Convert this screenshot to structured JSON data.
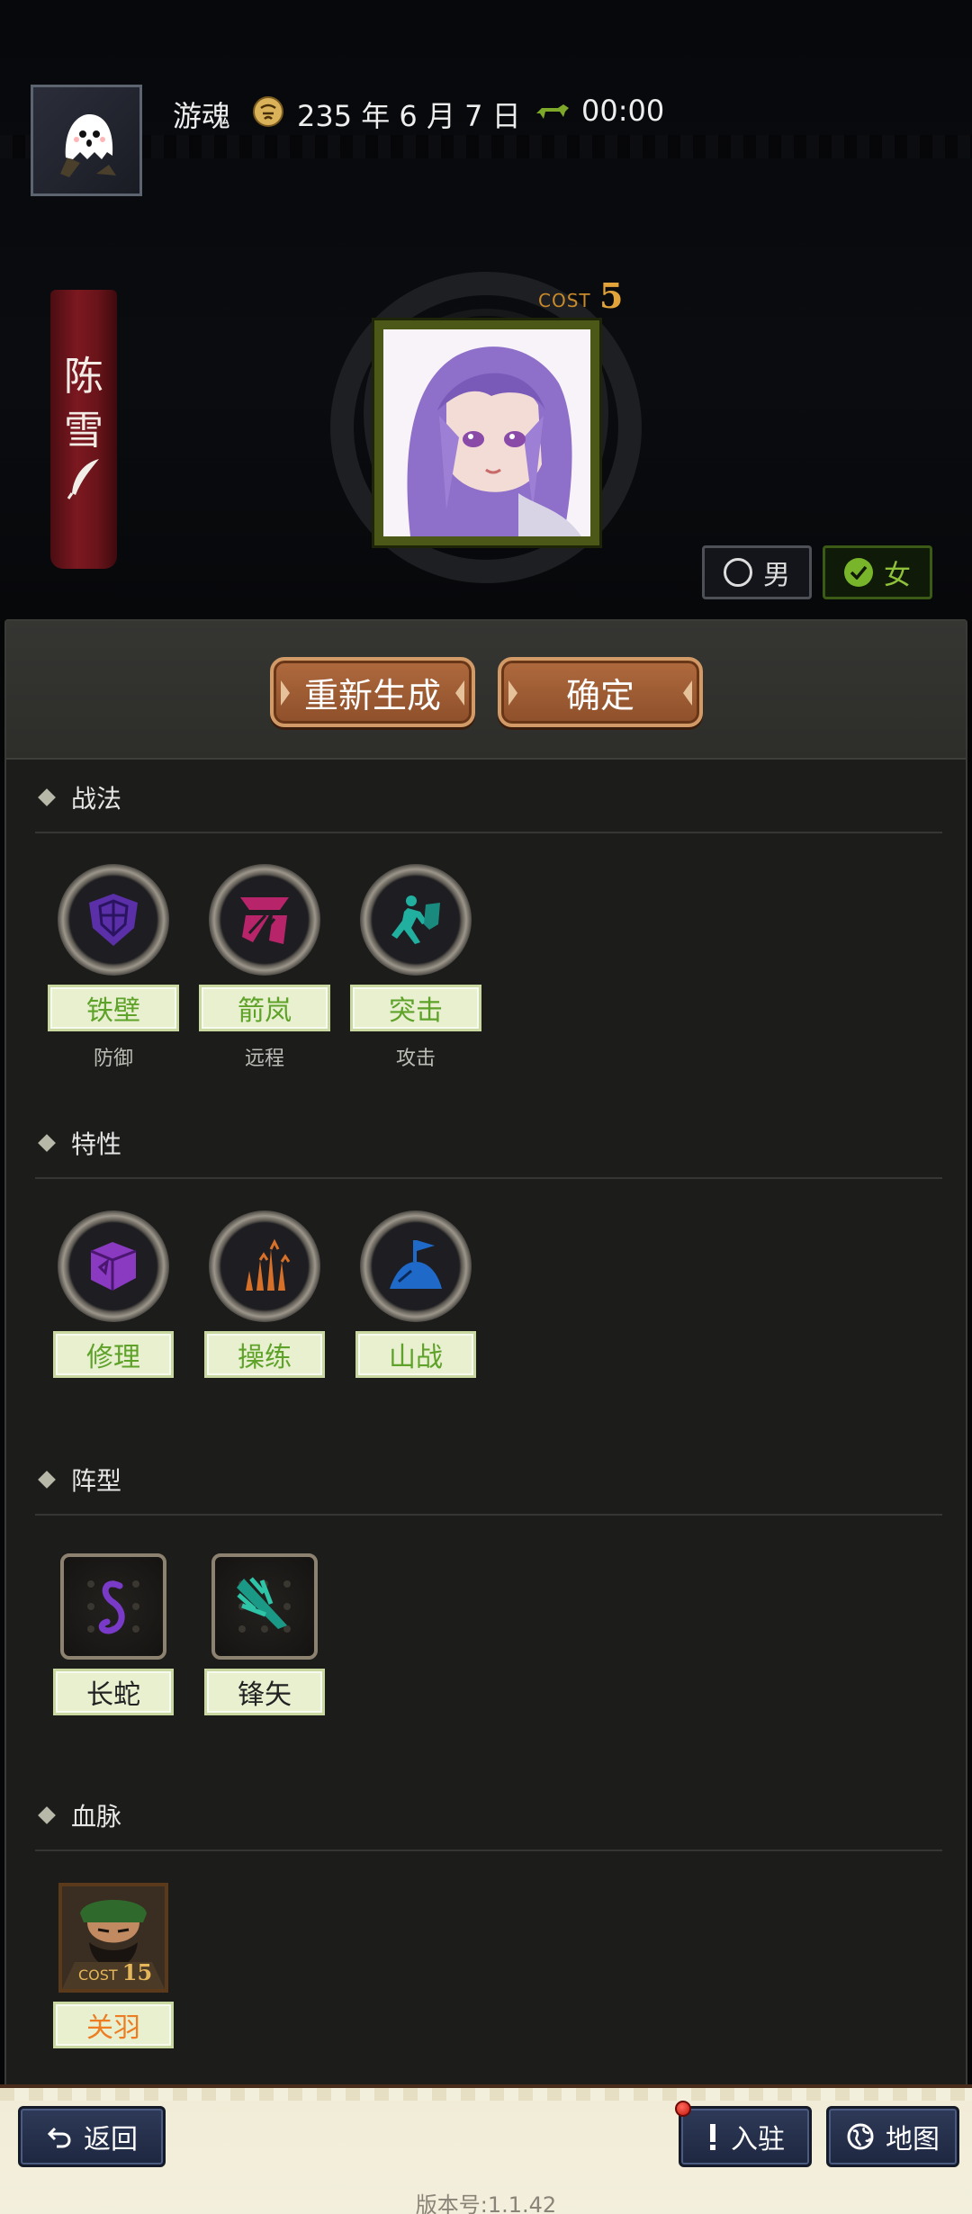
{
  "header": {
    "player_name": "游魂",
    "date": "235 年 6 月 7 日",
    "time": "00:00"
  },
  "character": {
    "name_char_1": "陈",
    "name_char_2": "雪",
    "cost_label": "COST",
    "cost_value": "5",
    "gender_male": "男",
    "gender_female": "女",
    "selected_gender": "女"
  },
  "actions": {
    "regenerate": "重新生成",
    "confirm": "确定"
  },
  "tactics": {
    "title": "战法",
    "items": [
      {
        "name": "铁壁",
        "type": "防御"
      },
      {
        "name": "箭岚",
        "type": "远程"
      },
      {
        "name": "突击",
        "type": "攻击"
      }
    ]
  },
  "traits": {
    "title": "特性",
    "items": [
      {
        "name": "修理"
      },
      {
        "name": "操练"
      },
      {
        "name": "山战"
      }
    ]
  },
  "formations": {
    "title": "阵型",
    "items": [
      {
        "name": "长蛇"
      },
      {
        "name": "锋矢"
      }
    ]
  },
  "bloodline": {
    "title": "血脉",
    "hero": {
      "name": "关羽",
      "cost_label": "COST",
      "cost": "15"
    }
  },
  "footer": {
    "back": "返回",
    "join": "入驻",
    "map": "地图",
    "version": "版本号:1.1.42"
  },
  "colors": {
    "accent_green": "#5ea229",
    "button_brown": "#9a5a32",
    "nav_blue": "#24304c",
    "banner_red": "#7c1820"
  }
}
